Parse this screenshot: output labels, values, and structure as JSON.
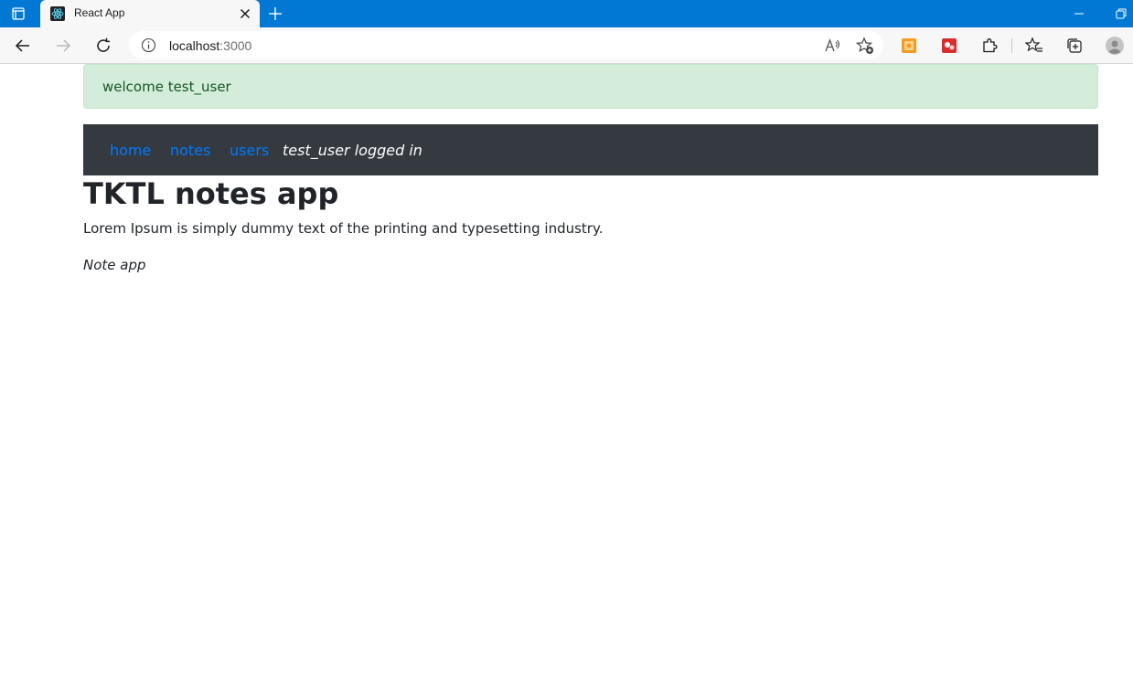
{
  "browser": {
    "tab": {
      "title": "React App"
    },
    "address": {
      "host": "localhost",
      "port": ":3000"
    }
  },
  "page": {
    "notification": "welcome test_user",
    "nav": {
      "links": [
        {
          "label": "home"
        },
        {
          "label": "notes"
        },
        {
          "label": "users"
        }
      ],
      "status": "test_user logged in"
    },
    "title": "TKTL notes app",
    "description": "Lorem Ipsum is simply dummy text of the printing and typesetting industry.",
    "footer": "Note app"
  },
  "colors": {
    "titlebar": "#0078d4",
    "alert_bg": "#d4edda",
    "alert_text": "#155724",
    "navbar_bg": "#343a40",
    "link": "#007bff"
  }
}
